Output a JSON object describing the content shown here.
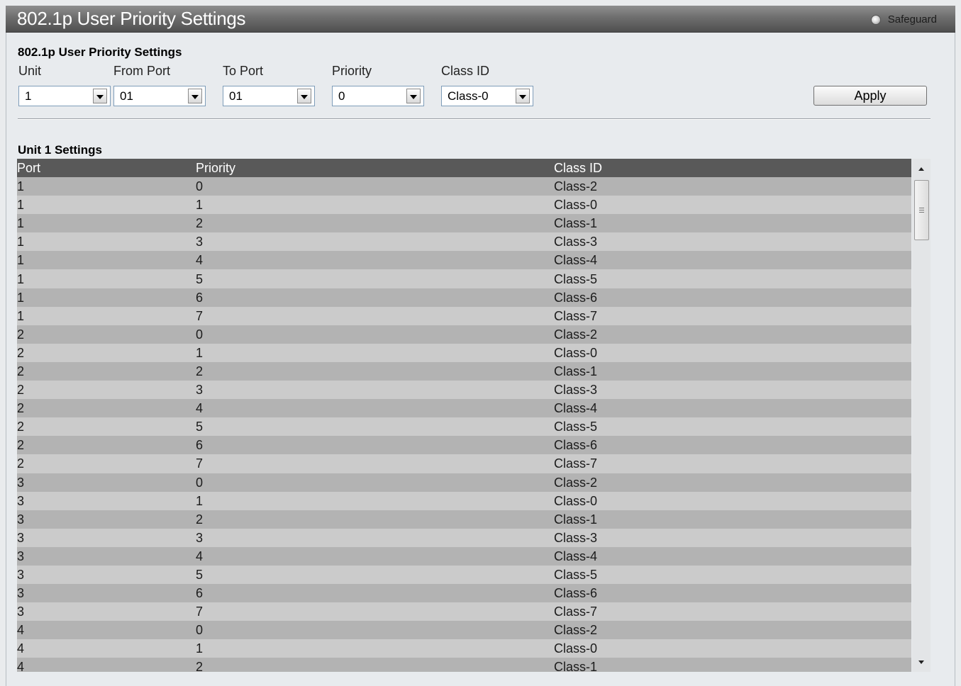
{
  "header": {
    "title": "802.1p User Priority Settings",
    "safeguard_label": "Safeguard"
  },
  "settings_form": {
    "section_title": "802.1p User Priority Settings",
    "unit": {
      "label": "Unit",
      "value": "1"
    },
    "from_port": {
      "label": "From Port",
      "value": "01"
    },
    "to_port": {
      "label": "To Port",
      "value": "01"
    },
    "priority": {
      "label": "Priority",
      "value": "0"
    },
    "class_id": {
      "label": "Class ID",
      "value": "Class-0"
    },
    "apply_label": "Apply"
  },
  "table": {
    "section_title": "Unit 1 Settings",
    "columns": [
      "Port",
      "Priority",
      "Class ID"
    ],
    "rows": [
      [
        "1",
        "0",
        "Class-2"
      ],
      [
        "1",
        "1",
        "Class-0"
      ],
      [
        "1",
        "2",
        "Class-1"
      ],
      [
        "1",
        "3",
        "Class-3"
      ],
      [
        "1",
        "4",
        "Class-4"
      ],
      [
        "1",
        "5",
        "Class-5"
      ],
      [
        "1",
        "6",
        "Class-6"
      ],
      [
        "1",
        "7",
        "Class-7"
      ],
      [
        "2",
        "0",
        "Class-2"
      ],
      [
        "2",
        "1",
        "Class-0"
      ],
      [
        "2",
        "2",
        "Class-1"
      ],
      [
        "2",
        "3",
        "Class-3"
      ],
      [
        "2",
        "4",
        "Class-4"
      ],
      [
        "2",
        "5",
        "Class-5"
      ],
      [
        "2",
        "6",
        "Class-6"
      ],
      [
        "2",
        "7",
        "Class-7"
      ],
      [
        "3",
        "0",
        "Class-2"
      ],
      [
        "3",
        "1",
        "Class-0"
      ],
      [
        "3",
        "2",
        "Class-1"
      ],
      [
        "3",
        "3",
        "Class-3"
      ],
      [
        "3",
        "4",
        "Class-4"
      ],
      [
        "3",
        "5",
        "Class-5"
      ],
      [
        "3",
        "6",
        "Class-6"
      ],
      [
        "3",
        "7",
        "Class-7"
      ],
      [
        "4",
        "0",
        "Class-2"
      ],
      [
        "4",
        "1",
        "Class-0"
      ],
      [
        "4",
        "2",
        "Class-1"
      ]
    ]
  }
}
